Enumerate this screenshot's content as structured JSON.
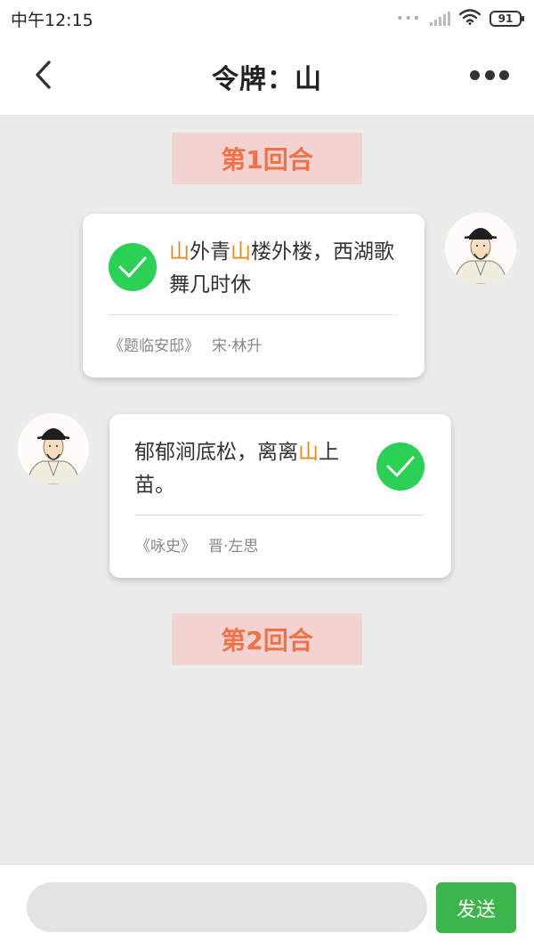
{
  "status_bar": {
    "time": "中午12:15",
    "battery": "91",
    "icons": [
      "signal-dots-icon",
      "signal-bars-icon",
      "wifi-icon",
      "battery-icon"
    ]
  },
  "nav": {
    "title": "令牌：山",
    "back_icon": "chevron-left-icon",
    "more_icon": "more-horizontal-icon"
  },
  "rounds": [
    {
      "label": "第1回合"
    },
    {
      "label": "第2回合"
    }
  ],
  "messages": [
    {
      "side": "right",
      "verse_parts": [
        {
          "text": "山",
          "highlight": true
        },
        {
          "text": "外青",
          "highlight": false
        },
        {
          "text": "山",
          "highlight": true
        },
        {
          "text": "楼外楼，西湖歌舞几时休",
          "highlight": false
        }
      ],
      "source_title": "《题临安邸》",
      "source_author": "宋·林升",
      "status_icon": "check-circle-icon"
    },
    {
      "side": "left",
      "verse_parts": [
        {
          "text": "郁郁涧底松，离离",
          "highlight": false
        },
        {
          "text": "山",
          "highlight": true
        },
        {
          "text": "上苗。",
          "highlight": false
        }
      ],
      "source_title": "《咏史》",
      "source_author": "晋·左思",
      "status_icon": "check-circle-icon"
    }
  ],
  "composer": {
    "input_value": "",
    "input_placeholder": "",
    "send_label": "发送"
  },
  "colors": {
    "highlight": "#e8891c",
    "round_text": "#f07348",
    "round_bg": "#f3d3d1",
    "check": "#2ad155",
    "send": "#3cb54a"
  }
}
